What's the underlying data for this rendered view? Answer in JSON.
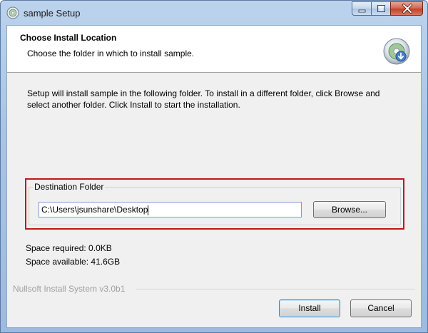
{
  "window": {
    "title": "sample Setup"
  },
  "header": {
    "title": "Choose Install Location",
    "subtitle": "Choose the folder in which to install sample."
  },
  "body": {
    "intro_line1": "Setup will install sample in the following folder. To install in a different folder, click Browse and",
    "intro_line2": "select another folder. Click Install to start the installation."
  },
  "destination": {
    "group_label": "Destination Folder",
    "path_value": "C:\\Users\\jsunshare\\Desktop",
    "browse_label": "Browse..."
  },
  "space": {
    "required": "Space required: 0.0KB",
    "available": "Space available: 41.6GB"
  },
  "footer": {
    "branding": "Nullsoft Install System v3.0b1",
    "install_label": "Install",
    "cancel_label": "Cancel"
  },
  "icons": {
    "app": "installer-disc-icon",
    "header": "install-disc-icon",
    "minimize": "minimize-icon",
    "maximize": "maximize-icon",
    "close": "close-icon"
  },
  "colors": {
    "highlight_border": "#c0161e",
    "titlebar": "#a9c4e4",
    "close_button": "#c4422a"
  }
}
